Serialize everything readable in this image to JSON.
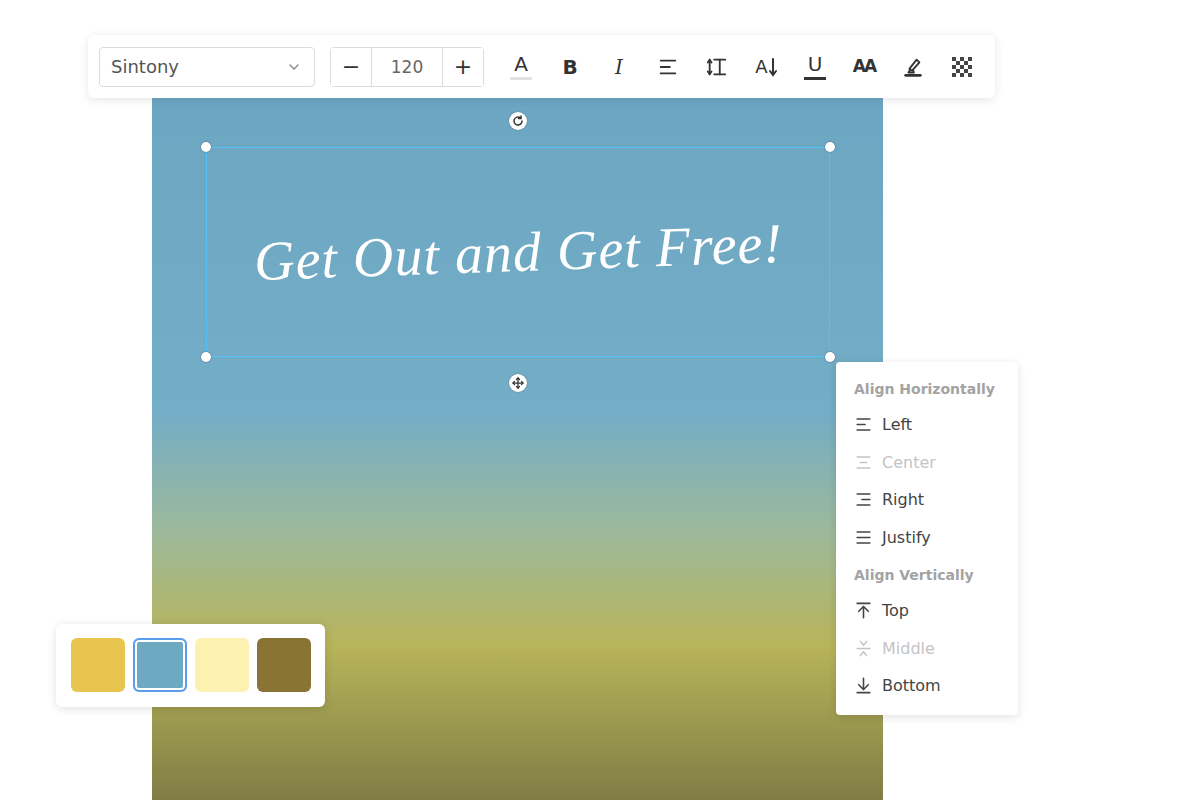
{
  "toolbar": {
    "font": "Sintony",
    "size": "120",
    "decrement": "−",
    "increment": "+",
    "tools": [
      {
        "kind": "color",
        "text": "A"
      },
      {
        "kind": "bold",
        "text": "B"
      },
      {
        "kind": "italic",
        "text": "I"
      },
      {
        "kind": "align"
      },
      {
        "kind": "lineheight"
      },
      {
        "kind": "spacing",
        "text": "A"
      },
      {
        "kind": "underline",
        "text": "U"
      },
      {
        "kind": "case",
        "text": "AA"
      },
      {
        "kind": "highlight"
      },
      {
        "kind": "opacity"
      }
    ]
  },
  "canvas": {
    "text": "Get Out and Get Free!",
    "selected": true
  },
  "align_menu": {
    "sections": [
      {
        "title": "Align Horizontally",
        "items": [
          {
            "label": "Left",
            "kind": "left",
            "disabled": false
          },
          {
            "label": "Center",
            "kind": "center",
            "disabled": true
          },
          {
            "label": "Right",
            "kind": "right",
            "disabled": false
          },
          {
            "label": "Justify",
            "kind": "justify",
            "disabled": false
          }
        ]
      },
      {
        "title": "Align Vertically",
        "items": [
          {
            "label": "Top",
            "kind": "top",
            "disabled": false
          },
          {
            "label": "Middle",
            "kind": "middle",
            "disabled": true
          },
          {
            "label": "Bottom",
            "kind": "bottom",
            "disabled": false
          }
        ]
      }
    ]
  },
  "palette": [
    {
      "color": "#e8c54e",
      "selected": false
    },
    {
      "color": "#6ea9c2",
      "selected": true
    },
    {
      "color": "#fcf1b0",
      "selected": false
    },
    {
      "color": "#8a7435",
      "selected": false
    }
  ]
}
